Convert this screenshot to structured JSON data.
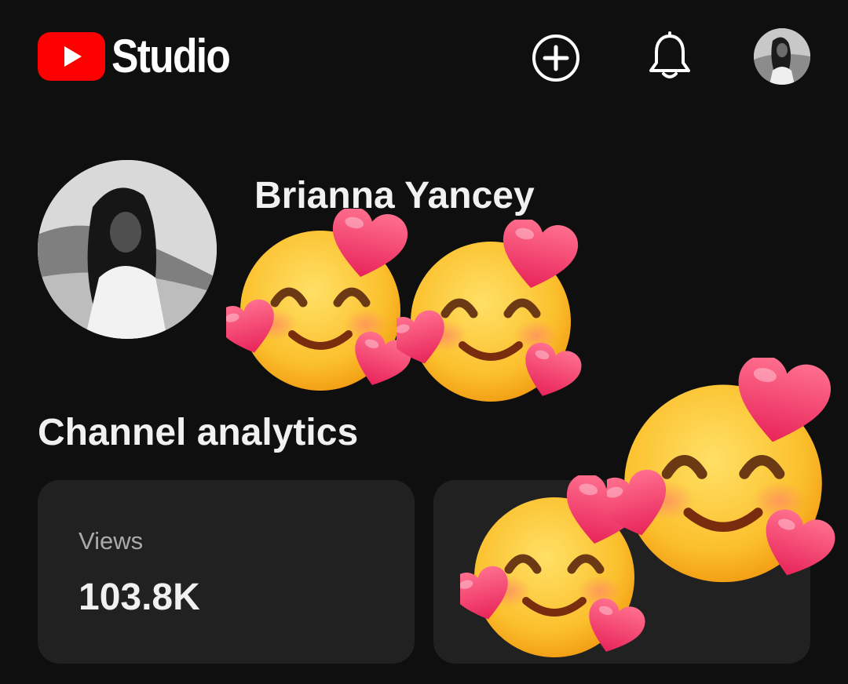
{
  "header": {
    "app_name": "Studio",
    "logo_icon": "youtube-logo-icon",
    "create_icon": "add-circle-icon",
    "notifications_icon": "bell-icon",
    "account_icon": "avatar"
  },
  "channel": {
    "name": "Brianna Yancey"
  },
  "analytics": {
    "title": "Channel analytics",
    "cards": [
      {
        "label": "Views",
        "value": "103.8K"
      },
      {
        "label": "",
        "value": ""
      }
    ]
  },
  "stickers": {
    "icon": "smiling-face-with-hearts-emoji",
    "count": 4
  },
  "colors": {
    "background": "#0f0f0f",
    "card": "#212121",
    "brand_red": "#ff0000",
    "text_primary": "#f1f1f1",
    "text_secondary": "#aaaaaa"
  }
}
